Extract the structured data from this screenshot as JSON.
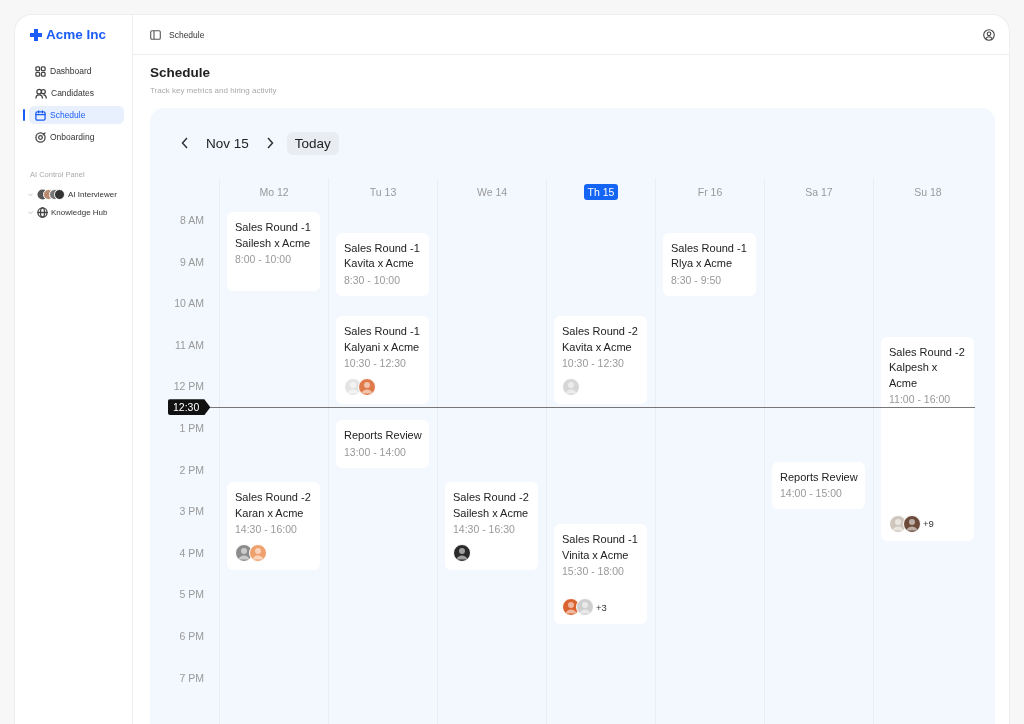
{
  "sidebar": {
    "brand": "Acme Inc",
    "items": [
      {
        "label": "Dashboard",
        "selected": false
      },
      {
        "label": "Candidates",
        "selected": false
      },
      {
        "label": "Schedule",
        "selected": true
      },
      {
        "label": "Onboarding",
        "selected": false
      }
    ],
    "section_title": "AI Control Panel",
    "section_items": [
      {
        "label": "AI Interviewer"
      },
      {
        "label": "Knowledge Hub"
      }
    ]
  },
  "header": {
    "breadcrumb": "Schedule"
  },
  "page": {
    "title": "Schedule",
    "subtitle": "Track key metrics and hiring activity"
  },
  "calendar": {
    "current": "Nov 15",
    "today_button": "Today",
    "now": "12:30",
    "hours": [
      "8 AM",
      "9 AM",
      "10 AM",
      "11 AM",
      "12 PM",
      "1 PM",
      "2 PM",
      "3 PM",
      "4 PM",
      "5 PM",
      "6 PM",
      "7 PM"
    ],
    "days": [
      {
        "label": "Mo 12",
        "selected": false,
        "events": [
          {
            "title": "Sales Round -1",
            "subtitle": "Sailesh x Acme",
            "time": "8:00 - 10:00"
          },
          {
            "title": "Sales Round -2",
            "subtitle": "Karan x Acme",
            "time": "14:30 - 16:00",
            "avatars": [
              {
                "color": "#8c8c8c"
              },
              {
                "color": "#f0a06a"
              }
            ]
          }
        ]
      },
      {
        "label": "Tu 13",
        "selected": false,
        "events": [
          {
            "title": "Sales Round -1",
            "subtitle": "Kavita x Acme",
            "time": "8:30 - 10:00"
          },
          {
            "title": "Sales Round -1",
            "subtitle": "Kalyani x Acme",
            "time": "10:30 - 12:30",
            "avatars": [
              {
                "color": "#e4e4e4"
              },
              {
                "color": "#e07a4a"
              }
            ]
          },
          {
            "title": "Reports Review",
            "time": "13:00 - 14:00"
          }
        ]
      },
      {
        "label": "We 14",
        "selected": false,
        "events": [
          {
            "title": "Sales Round -2",
            "subtitle": "Sailesh x Acme",
            "time": "14:30 - 16:30",
            "avatars": [
              {
                "color": "#2a2a2a"
              }
            ]
          }
        ]
      },
      {
        "label": "Th 15",
        "selected": true,
        "events": [
          {
            "title": "Sales Round -2",
            "subtitle": "Kavita x Acme",
            "time": "10:30 - 12:30",
            "avatars": [
              {
                "color": "#d6d6d6"
              }
            ]
          },
          {
            "title": "Sales Round -1",
            "subtitle": "Vinita x Acme",
            "time": "15:30 - 18:00",
            "avatars": [
              {
                "color": "#d9622e"
              },
              {
                "color": "#cfcfcf"
              }
            ],
            "more": "+3"
          }
        ]
      },
      {
        "label": "Fr 16",
        "selected": false,
        "events": [
          {
            "title": "Sales Round -1",
            "subtitle": "Rlya x Acme",
            "time": "8:30 - 9:50"
          }
        ]
      },
      {
        "label": "Sa 17",
        "selected": false,
        "events": [
          {
            "title": "Reports Review",
            "time": "14:00 - 15:00"
          }
        ]
      },
      {
        "label": "Su 18",
        "selected": false,
        "events": [
          {
            "title": "Sales Round -2",
            "subtitle": "Kalpesh x Acme",
            "time": "11:00 - 16:00",
            "avatars": [
              {
                "color": "#cfc6bd"
              },
              {
                "color": "#6b4a3a"
              }
            ],
            "more": "+9"
          }
        ]
      }
    ]
  }
}
